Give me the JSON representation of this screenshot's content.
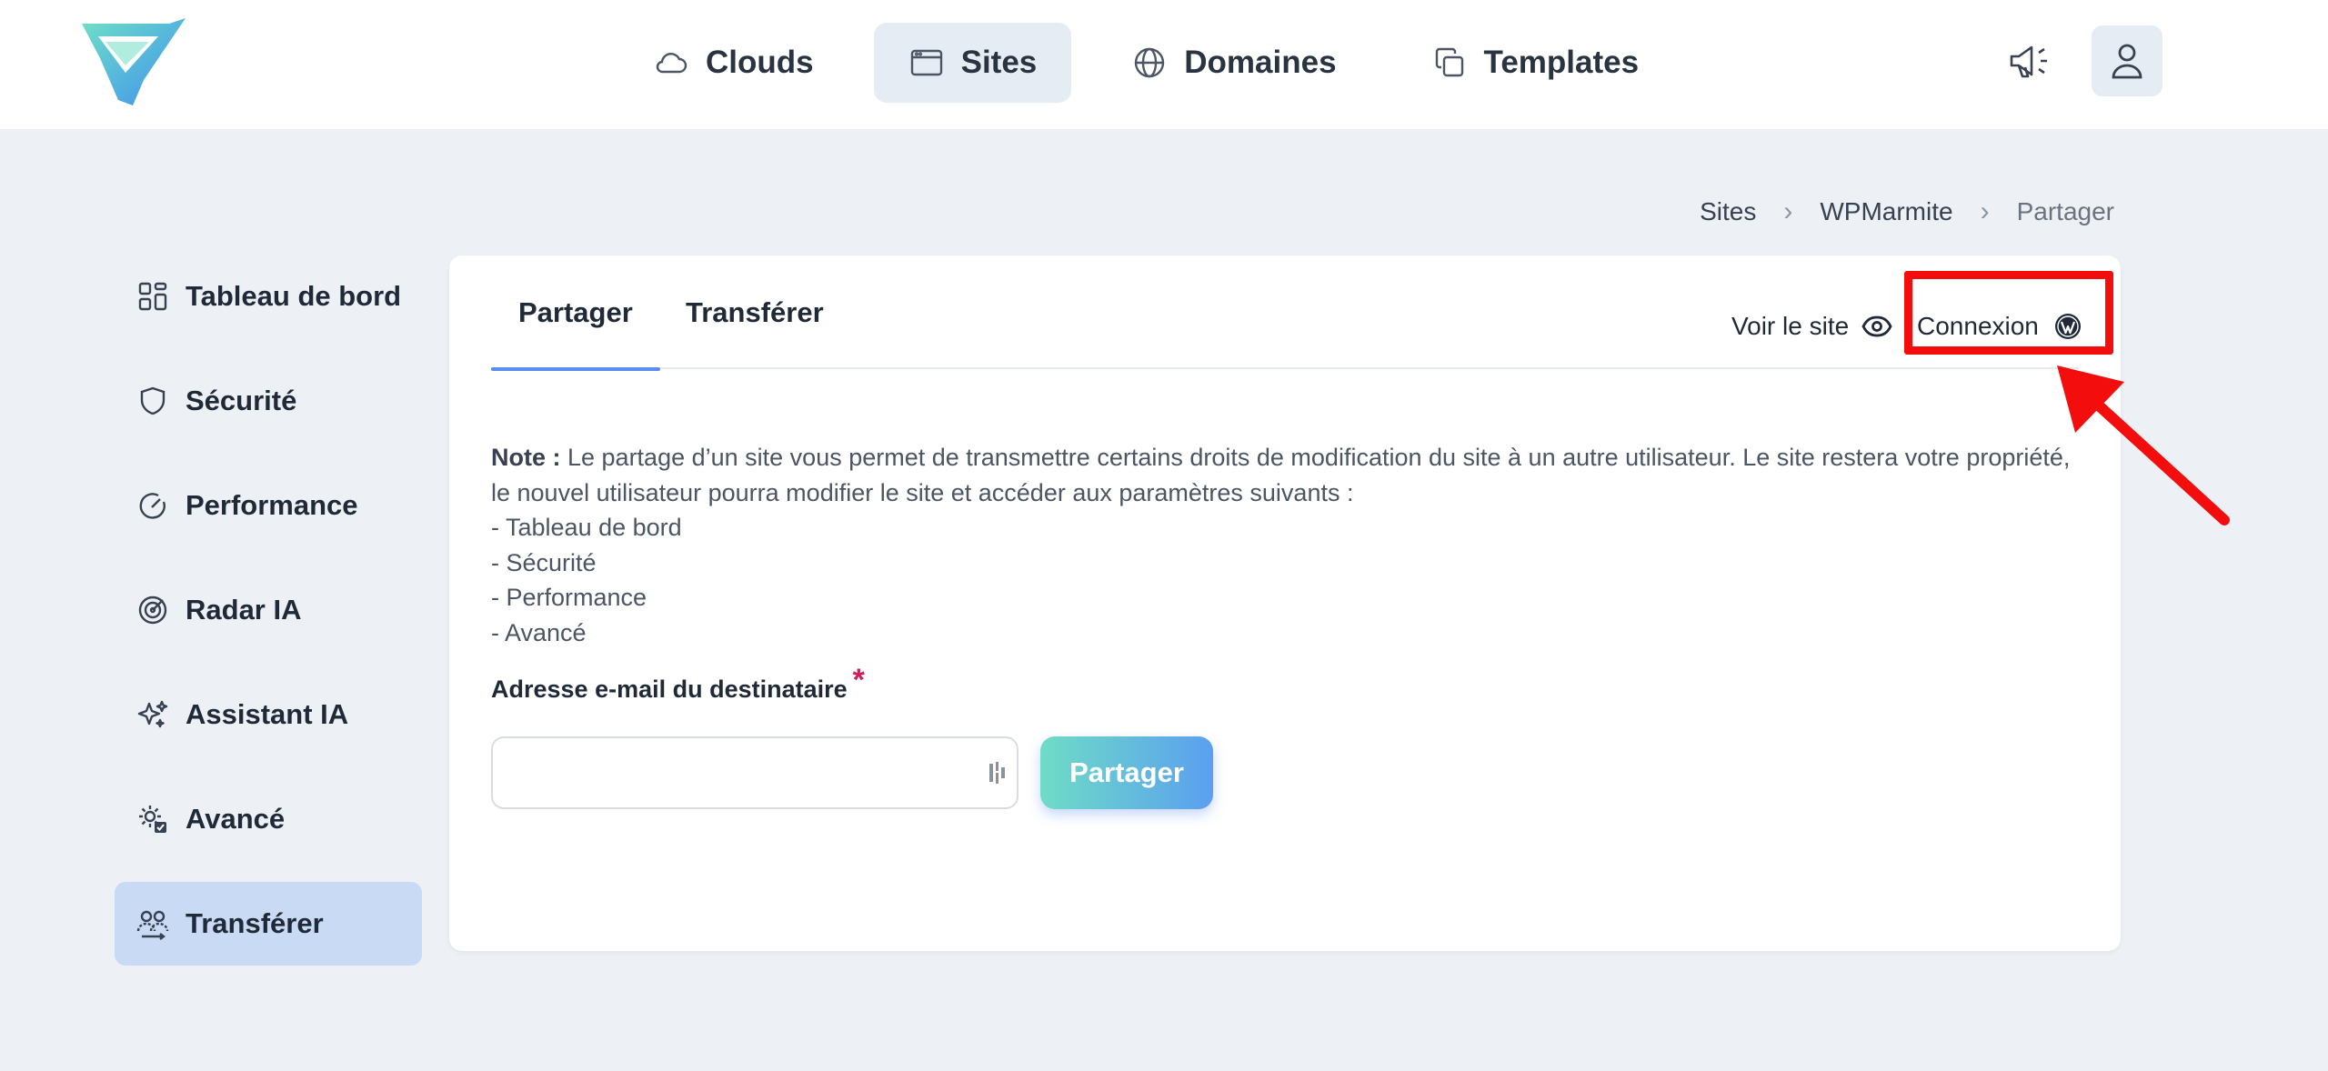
{
  "header": {
    "nav": [
      {
        "label": "Clouds",
        "icon": "cloud-icon",
        "active": false
      },
      {
        "label": "Sites",
        "icon": "browser-window-icon",
        "active": true
      },
      {
        "label": "Domaines",
        "icon": "globe-icon",
        "active": false
      },
      {
        "label": "Templates",
        "icon": "copy-icon",
        "active": false
      }
    ]
  },
  "breadcrumb": [
    "Sites",
    "WPMarmite",
    "Partager"
  ],
  "sidebar": {
    "items": [
      {
        "label": "Tableau de bord",
        "icon": "dashboard-icon"
      },
      {
        "label": "Sécurité",
        "icon": "shield-icon"
      },
      {
        "label": "Performance",
        "icon": "speedometer-icon"
      },
      {
        "label": "Radar IA",
        "icon": "radar-icon"
      },
      {
        "label": "Assistant IA",
        "icon": "sparkles-icon"
      },
      {
        "label": "Avancé",
        "icon": "gear-check-icon"
      },
      {
        "label": "Transférer",
        "icon": "users-transfer-icon",
        "active": true
      }
    ]
  },
  "card": {
    "tabs": [
      "Partager",
      "Transférer"
    ],
    "view_site": "Voir le site",
    "connexion": "Connexion",
    "note_prefix": "Note :",
    "note_text": " Le partage d’un site vous permet de transmettre certains droits de modification du site à un autre utilisateur. Le site restera votre propriété, le nouvel utilisateur pourra modifier le site et accéder aux paramètres suivants :",
    "note_list": [
      "- Tableau de bord",
      "- Sécurité",
      "- Performance",
      "- Avancé"
    ],
    "email_label": "Adresse e-mail du destinataire",
    "required_mark": "*",
    "email_value": "",
    "share_button": "Partager"
  },
  "colors": {
    "accent": "#5b8cf0",
    "highlight": "#f40d0d",
    "active_sidebar": "#c9daf4"
  }
}
